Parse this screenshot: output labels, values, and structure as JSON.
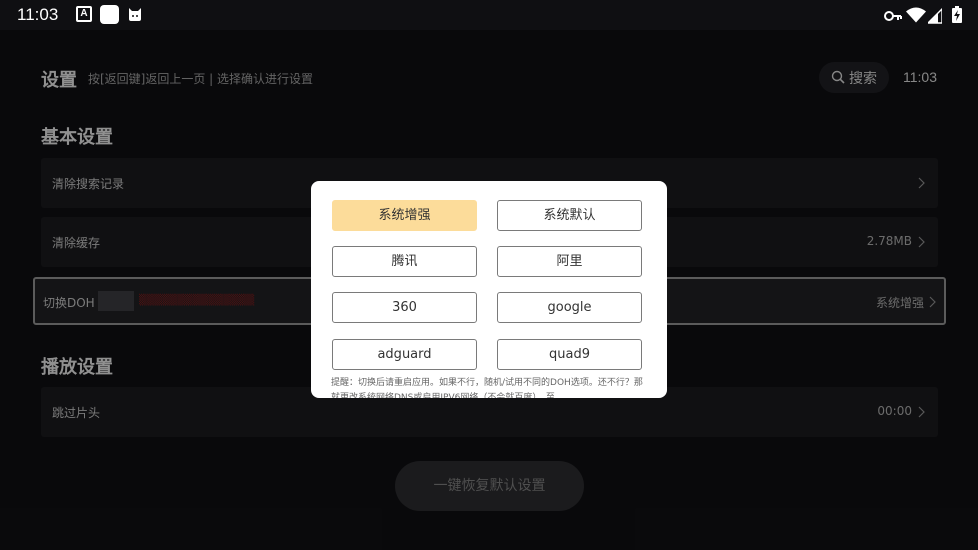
{
  "statusbar": {
    "time": "11:03",
    "notification_a": "A",
    "icons": [
      "a-box-icon",
      "square-app-icon",
      "cat-icon",
      "key-icon",
      "wifi-icon",
      "signal-icon",
      "battery-charging-icon"
    ]
  },
  "header": {
    "title": "设置",
    "hint": "按[返回键]返回上一页 | 选择确认进行设置",
    "search_label": "搜索",
    "clock": "11:03"
  },
  "sections": {
    "basic": "基本设置",
    "playback": "播放设置"
  },
  "rows": {
    "clear_search": {
      "label": "清除搜索记录",
      "value": ""
    },
    "clear_cache": {
      "label": "清除缓存",
      "value": "2.78MB"
    },
    "doh": {
      "label": "切换DOH",
      "value": "系统增强"
    },
    "skip_intro": {
      "label": "跳过片头",
      "value": "00:00"
    }
  },
  "reset_button": "一键恢复默认设置",
  "dialog": {
    "options": [
      "系统增强",
      "系统默认",
      "腾讯",
      "阿里",
      "360",
      "google",
      "adguard",
      "quad9"
    ],
    "selected": "系统增强",
    "tip": "提醒：切换后请重启应用。如果不行，随机/试用不同的DOH选项。还不行？那就更改系统网络DNS或启用IPV6网络（不会就百度）。至"
  },
  "colors": {
    "background": "#0f0f12",
    "row_bg": "#1a1a1d",
    "selected_option": "#fcdc9a"
  }
}
